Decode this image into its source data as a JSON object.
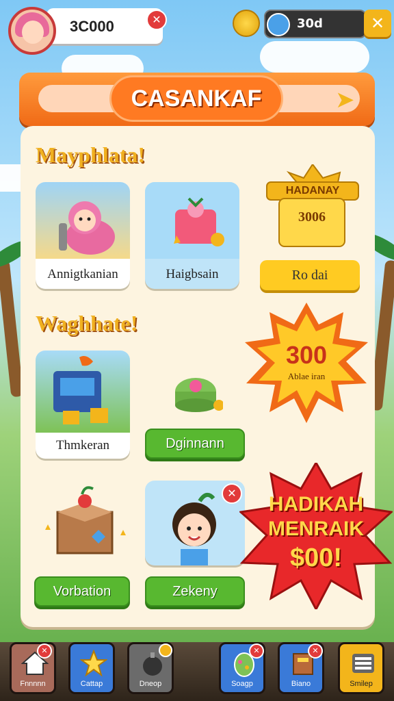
{
  "header": {
    "player_value": "3C000",
    "gem_value": "30d"
  },
  "banner": {
    "title": "CASANKAF"
  },
  "section1": {
    "title": "Mayphlata!",
    "cards": [
      {
        "label": "Annigtkanian"
      },
      {
        "label": "Haigbsain"
      }
    ],
    "prize": {
      "sign": "HADANAY",
      "value": "3006",
      "button": "Ro dai"
    }
  },
  "section2": {
    "title": "Waghhate!",
    "cards": [
      {
        "label": "Thmkeran"
      }
    ],
    "button_center": "Dginnann",
    "burst": {
      "value": "300",
      "sub": "Ablae iran"
    }
  },
  "section3": {
    "buttons": [
      "Vorbation",
      "Zekeny"
    ],
    "burst": {
      "line1": "HADIKAH",
      "line2": "MENRAIK",
      "line3": "$00!"
    }
  },
  "nav": {
    "items": [
      {
        "label": "Fnnnnn",
        "icon": "house-icon",
        "color": "#a86a5a"
      },
      {
        "label": "Cattap",
        "icon": "star-icon",
        "color": "#3a7ad8"
      },
      {
        "label": "Dneop",
        "icon": "bomb-icon",
        "color": "#6b6b6b"
      },
      {
        "label": "Soagp",
        "icon": "egg-icon",
        "color": "#3a7ad8"
      },
      {
        "label": "Biano",
        "icon": "book-icon",
        "color": "#3a7ad8"
      },
      {
        "label": "Smilep",
        "icon": "list-icon",
        "color": "#f3b51b"
      }
    ]
  },
  "colors": {
    "accent_orange": "#f06a16",
    "green_button": "#58b830",
    "yellow_button": "#ffcb22",
    "burst_red": "#e8282a"
  }
}
